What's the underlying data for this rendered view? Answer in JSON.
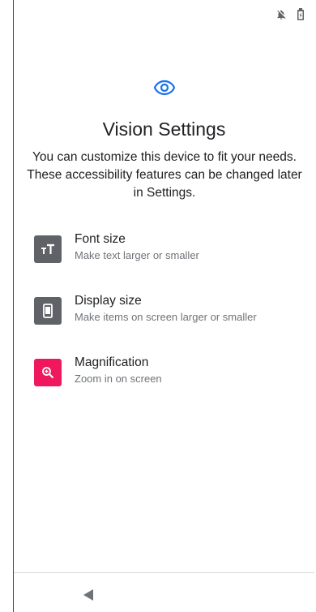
{
  "status_bar": {
    "icons": [
      "notifications-off-icon",
      "battery-icon"
    ]
  },
  "header": {
    "icon": "eye-icon",
    "title": "Vision Settings",
    "description": "You can customize this device to fit your needs. These accessibility features can be changed later in Settings."
  },
  "features": [
    {
      "icon": "font-size-icon",
      "title": "Font size",
      "subtitle": "Make text larger or smaller",
      "color": "#5f6368"
    },
    {
      "icon": "display-size-icon",
      "title": "Display size",
      "subtitle": "Make items on screen larger or smaller",
      "color": "#5f6368"
    },
    {
      "icon": "magnification-icon",
      "title": "Magnification",
      "subtitle": "Zoom in on screen",
      "color": "#f0185c"
    }
  ],
  "nav": {
    "back_icon": "back-triangle-icon"
  },
  "colors": {
    "accent": "#1a73e8",
    "gray_icon_bg": "#5f6368",
    "magnification_bg": "#f0185c"
  }
}
